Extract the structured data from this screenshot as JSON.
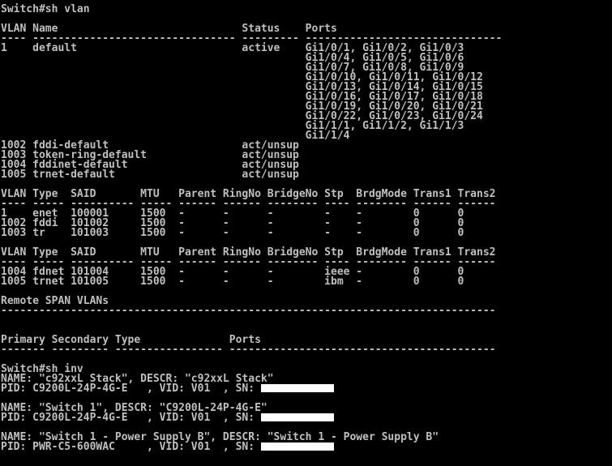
{
  "colors": {
    "background": "#000000",
    "foreground": "#c0c0c0",
    "redaction": "#ffffff"
  },
  "terminal": {
    "lines": [
      "Switch#sh vlan",
      "",
      "VLAN Name                             Status    Ports",
      "---- -------------------------------- --------- -------------------------------",
      "1    default                          active    Gi1/0/1, Gi1/0/2, Gi1/0/3",
      "                                                Gi1/0/4, Gi1/0/5, Gi1/0/6",
      "                                                Gi1/0/7, Gi1/0/8, Gi1/0/9",
      "                                                Gi1/0/10, Gi1/0/11, Gi1/0/12",
      "                                                Gi1/0/13, Gi1/0/14, Gi1/0/15",
      "                                                Gi1/0/16, Gi1/0/17, Gi1/0/18",
      "                                                Gi1/0/19, Gi1/0/20, Gi1/0/21",
      "                                                Gi1/0/22, Gi1/0/23, Gi1/0/24",
      "                                                Gi1/1/1, Gi1/1/2, Gi1/1/3",
      "                                                Gi1/1/4",
      "1002 fddi-default                     act/unsup",
      "1003 token-ring-default               act/unsup",
      "1004 fddinet-default                  act/unsup",
      "1005 trnet-default                    act/unsup",
      "",
      "VLAN Type  SAID       MTU   Parent RingNo BridgeNo Stp  BrdgMode Trans1 Trans2",
      "---- ----- ---------- ----- ------ ------ -------- ---- -------- ------ ------",
      "1    enet  100001     1500  -      -      -        -    -        0      0",
      "1002 fddi  101002     1500  -      -      -        -    -        0      0",
      "1003 tr    101003     1500  -      -      -        -    -        0      0",
      "",
      "VLAN Type  SAID       MTU   Parent RingNo BridgeNo Stp  BrdgMode Trans1 Trans2",
      "---- ----- ---------- ----- ------ ------ -------- ---- -------- ------ ------",
      "1004 fdnet 101004     1500  -      -      -        ieee -        0      0",
      "1005 trnet 101005     1500  -      -      -        ibm  -        0      0",
      "",
      "Remote SPAN VLANs",
      "------------------------------------------------------------------------------",
      "",
      "",
      "Primary Secondary Type              Ports",
      "------- --------- ----------------- ------------------------------------------",
      "",
      "Switch#sh inv",
      "NAME: \"c92xxL Stack\", DESCR: \"c92xxL Stack\"",
      "PID: C9200L-24P-4G-E   , VID: V01  , SN: ",
      "",
      "NAME: \"Switch 1\", DESCR: \"C9200L-24P-4G-E\"",
      "PID: C9200L-24P-4G-E   , VID: V01  , SN: ",
      "",
      "NAME: \"Switch 1 - Power Supply B\", DESCR: \"Switch 1 - Power Supply B\"",
      "PID: PWR-C5-600WAC     , VID: V01  , SN: "
    ],
    "redacted_lines": [
      39,
      42,
      45
    ]
  }
}
